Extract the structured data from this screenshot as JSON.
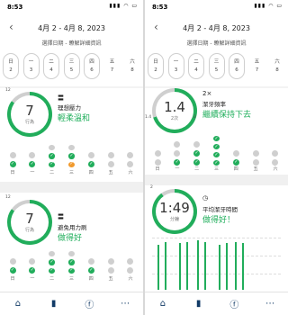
{
  "status": {
    "time": "8:53",
    "icons": "▮▮▮ ◠ ▭"
  },
  "header": {
    "back": "‹",
    "range": "4月 2 - 4月 8, 2023",
    "hint": "選擇日期 - 瞭解詳細資訊",
    "days": [
      {
        "name": "日",
        "num": "2"
      },
      {
        "name": "一",
        "num": "3"
      },
      {
        "name": "二",
        "num": "4"
      },
      {
        "name": "三",
        "num": "5"
      },
      {
        "name": "四",
        "num": "6"
      },
      {
        "name": "五",
        "num": "7"
      },
      {
        "name": "六",
        "num": "8"
      }
    ]
  },
  "day_labels": [
    "日",
    "一",
    "二",
    "三",
    "四",
    "五",
    "六"
  ],
  "colors": {
    "green": "#21ad5b",
    "orange": "#f19a2e",
    "empty": "#cfcfcf"
  },
  "left": {
    "pressure": {
      "ring_value": "7",
      "ring_unit": "行為",
      "ring_fraction": 0.85,
      "tick_top": "12",
      "icon": "brush-icon",
      "icon_glyph": "〓",
      "title": "理想壓力",
      "status": "輕柔溫和",
      "dots": [
        [
          "g",
          "e"
        ],
        [
          "g",
          "e"
        ],
        [
          "g",
          "g",
          "e"
        ],
        [
          "o",
          "g",
          "e"
        ],
        [
          "g",
          "e"
        ],
        [
          "e",
          "e"
        ],
        [
          "e",
          "e"
        ]
      ]
    },
    "scrub": {
      "ring_value": "7",
      "ring_unit": "行為",
      "ring_fraction": 0.85,
      "tick_top": "12",
      "icon": "brush-motion-icon",
      "icon_glyph": "〓",
      "title": "避免用力刷",
      "status": "做得好",
      "dots": [
        [
          "g",
          "e"
        ],
        [
          "g",
          "e"
        ],
        [
          "g",
          "g",
          "e"
        ],
        [
          "g",
          "g",
          "e"
        ],
        [
          "g",
          "e"
        ],
        [
          "e",
          "e"
        ],
        [
          "e",
          "e"
        ]
      ]
    }
  },
  "right": {
    "frequency": {
      "ring_value": "1.4",
      "ring_unit": "2次",
      "ring_fraction": 0.7,
      "tick_left": "1.4",
      "tick_right": "2",
      "icon": "times-icon",
      "icon_glyph": "2×",
      "title": "潔牙頻率",
      "status": "繼續保持下去",
      "dots": [
        [
          "e",
          "e"
        ],
        [
          "g",
          "e",
          "e"
        ],
        [
          "g",
          "g",
          "e"
        ],
        [
          "g",
          "g",
          "g",
          "g"
        ],
        [
          "g",
          "e"
        ],
        [
          "e",
          "e"
        ],
        [
          "e",
          "e"
        ]
      ]
    },
    "time": {
      "ring_value": "1:49",
      "ring_unit": "分鐘",
      "ring_fraction": 0.9,
      "tick_top": "2",
      "icon": "timer-icon",
      "icon_glyph": "◷",
      "title": "平均潔牙時間",
      "status": "做得好！",
      "chart_data": {
        "type": "bar",
        "values": [
          1.8,
          1.9,
          1.85,
          1.9,
          1.95,
          1.9,
          1.8,
          1.85,
          1.9,
          1.85
        ]
      }
    }
  },
  "tabs": [
    {
      "name": "home",
      "glyph": "⌂"
    },
    {
      "name": "stats",
      "glyph": "▮"
    },
    {
      "name": "brush",
      "glyph": "ⓕ"
    },
    {
      "name": "more",
      "glyph": "⋯"
    }
  ]
}
